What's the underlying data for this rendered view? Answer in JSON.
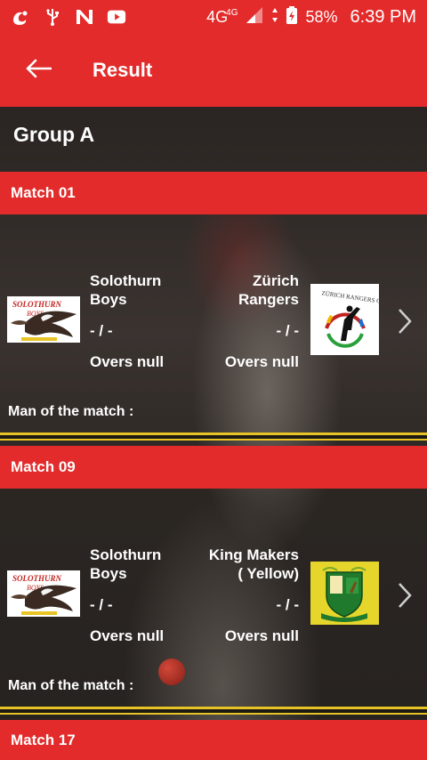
{
  "status_bar": {
    "network": "4G",
    "network_small": "4G",
    "battery": "58%",
    "time": "6:39 PM",
    "icons": [
      "uc-browser-icon",
      "usb-icon",
      "n-app-icon",
      "youtube-icon"
    ]
  },
  "app_bar": {
    "title": "Result",
    "back_icon": "arrow-back-icon"
  },
  "group": {
    "title": "Group A"
  },
  "matches": [
    {
      "header": "Match 01",
      "team1": {
        "name_line1": "Solothurn",
        "name_line2": "Boys",
        "score": "- / -",
        "overs": "Overs null",
        "logo": "solothurn-boys-logo"
      },
      "team2": {
        "name_line1": "Zürich",
        "name_line2": "Rangers",
        "score": "- / -",
        "overs": "Overs null",
        "logo": "zurich-rangers-logo",
        "logo_text": "ZÜRICH RANGERS C.C"
      },
      "man_of_the_match": "Man of the match :"
    },
    {
      "header": "Match 09",
      "team1": {
        "name_line1": "Solothurn",
        "name_line2": "Boys",
        "score": "- / -",
        "overs": "Overs null",
        "logo": "solothurn-boys-logo"
      },
      "team2": {
        "name_line1": "King Makers",
        "name_line2": "( Yellow)",
        "score": "- / -",
        "overs": "Overs null",
        "logo": "king-makers-logo"
      },
      "man_of_the_match": "Man of the match :"
    },
    {
      "header": "Match 17"
    }
  ],
  "colors": {
    "accent": "#e32b2b",
    "divider": "#e8c325"
  }
}
